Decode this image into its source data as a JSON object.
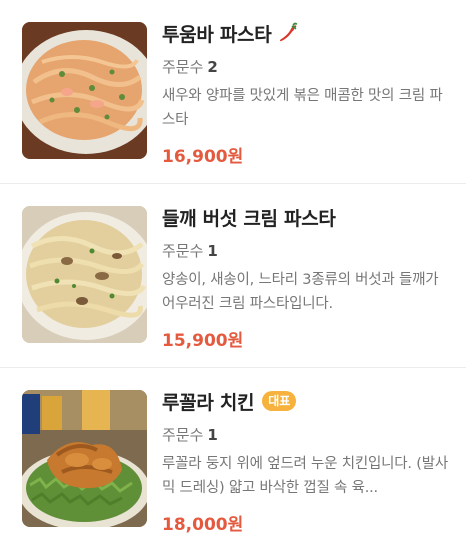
{
  "items": [
    {
      "name": "투움바 파스타",
      "orders_label": "주문수",
      "orders_count": "2",
      "description": "새우와 양파를 맛있게 볶은 매콤한 맛의 크림 파스타",
      "price": "16,900원",
      "icon": "chili-pepper-icon"
    },
    {
      "name": "들깨 버섯 크림 파스타",
      "orders_label": "주문수",
      "orders_count": "1",
      "description": "양송이, 새송이, 느타리 3종류의 버섯과 들깨가 어우러진 크림 파스타입니다.",
      "price": "15,900원"
    },
    {
      "name": "루꼴라 치킨",
      "badge": "대표",
      "orders_label": "주문수",
      "orders_count": "1",
      "description": "루꼴라 둥지 위에 엎드려 누운 치킨입니다. (발사믹 드레싱) 얇고 바삭한 껍질 속 육...",
      "price": "18,000원"
    }
  ],
  "colors": {
    "price": "#e45a3f",
    "badge": "#f6b23c",
    "divider": "#ececec"
  }
}
